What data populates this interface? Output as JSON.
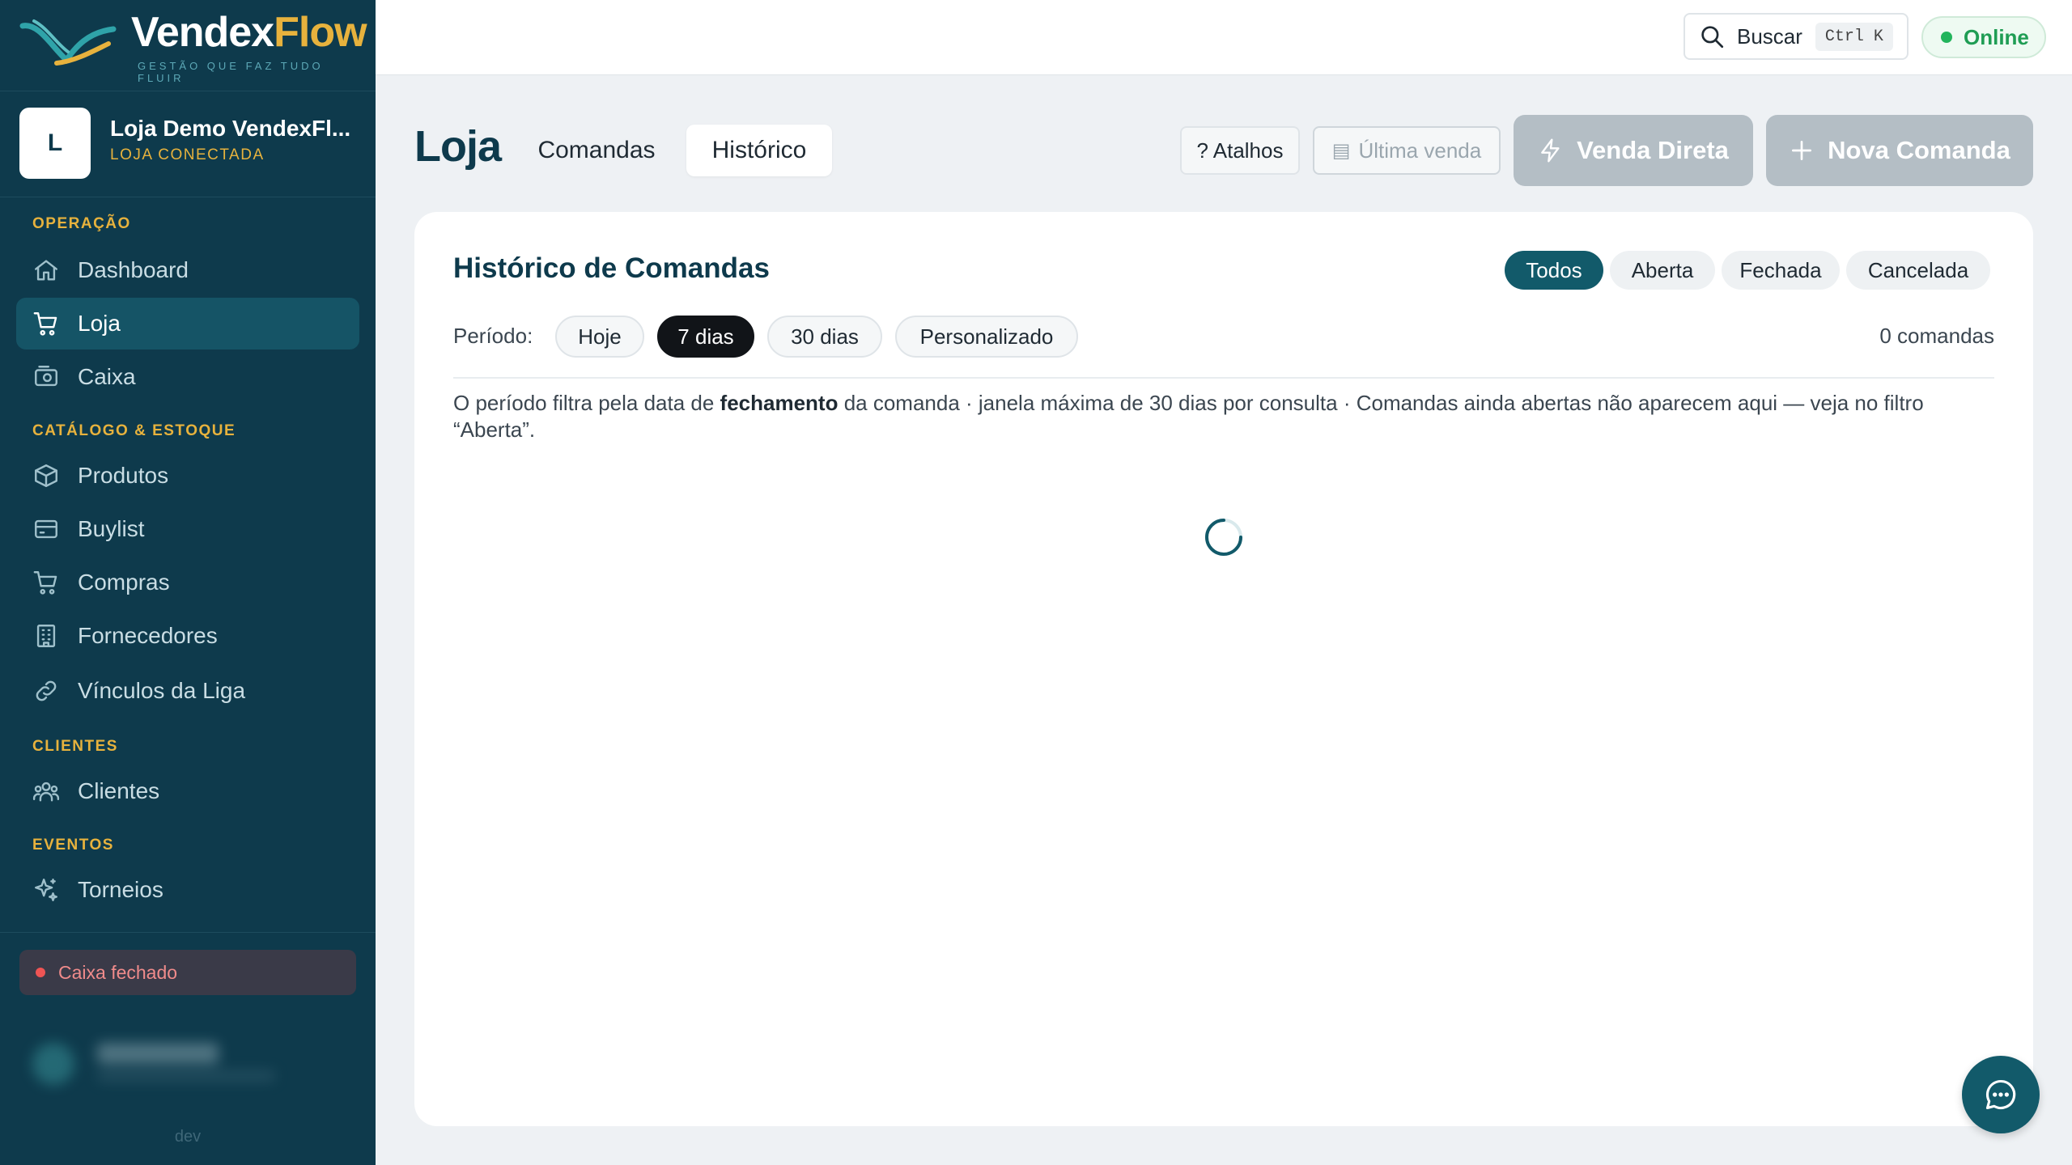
{
  "brand": {
    "name_part1": "Vendex",
    "name_part2": "Flow",
    "tagline": "GESTÃO QUE FAZ TUDO FLUIR"
  },
  "store": {
    "initial": "L",
    "name": "Loja Demo VendexFl...",
    "status": "LOJA CONECTADA"
  },
  "sidebar": {
    "sections": [
      {
        "label": "OPERAÇÃO",
        "items": [
          {
            "label": "Dashboard",
            "icon": "home-icon"
          },
          {
            "label": "Loja",
            "icon": "cart-icon",
            "active": true
          },
          {
            "label": "Caixa",
            "icon": "cash-register-icon"
          }
        ]
      },
      {
        "label": "CATÁLOGO & ESTOQUE",
        "items": [
          {
            "label": "Produtos",
            "icon": "box-icon"
          },
          {
            "label": "Buylist",
            "icon": "card-icon"
          },
          {
            "label": "Compras",
            "icon": "cart-icon"
          },
          {
            "label": "Fornecedores",
            "icon": "building-icon"
          },
          {
            "label": "Vínculos da Liga",
            "icon": "link-icon"
          }
        ]
      },
      {
        "label": "CLIENTES",
        "items": [
          {
            "label": "Clientes",
            "icon": "users-icon"
          }
        ]
      },
      {
        "label": "EVENTOS",
        "items": [
          {
            "label": "Torneios",
            "icon": "sparkle-icon"
          }
        ]
      }
    ],
    "caixa_status": "Caixa fechado",
    "env_label": "dev"
  },
  "topbar": {
    "search_label": "Buscar",
    "search_shortcut": "Ctrl K",
    "connection_status": "Online"
  },
  "page": {
    "title": "Loja",
    "tabs": [
      {
        "label": "Comandas",
        "active": false
      },
      {
        "label": "Histórico",
        "active": true
      }
    ],
    "actions": {
      "shortcuts": "? Atalhos",
      "last_sale": "Última venda",
      "direct_sale": "Venda Direta",
      "new_order": "Nova Comanda"
    }
  },
  "history": {
    "title": "Histórico de Comandas",
    "status_filters": [
      {
        "label": "Todos",
        "selected": true
      },
      {
        "label": "Aberta",
        "selected": false
      },
      {
        "label": "Fechada",
        "selected": false
      },
      {
        "label": "Cancelada",
        "selected": false
      }
    ],
    "period_label": "Período:",
    "period_options": [
      {
        "label": "Hoje",
        "selected": false
      },
      {
        "label": "7 dias",
        "selected": true
      },
      {
        "label": "30 dias",
        "selected": false
      },
      {
        "label": "Personalizado",
        "selected": false
      }
    ],
    "count": "0 comandas",
    "note_pre": "O período filtra pela data de ",
    "note_bold": "fechamento",
    "note_post": " da comanda · janela máxima de 30 dias por consulta · Comandas ainda abertas não aparecem aqui — veja no filtro “Aberta”."
  },
  "colors": {
    "sidebar_bg": "#0e3a4c",
    "accent": "#125a6a",
    "brand_gold": "#e7b23d",
    "online": "#22b45c",
    "danger": "#ef5454"
  }
}
